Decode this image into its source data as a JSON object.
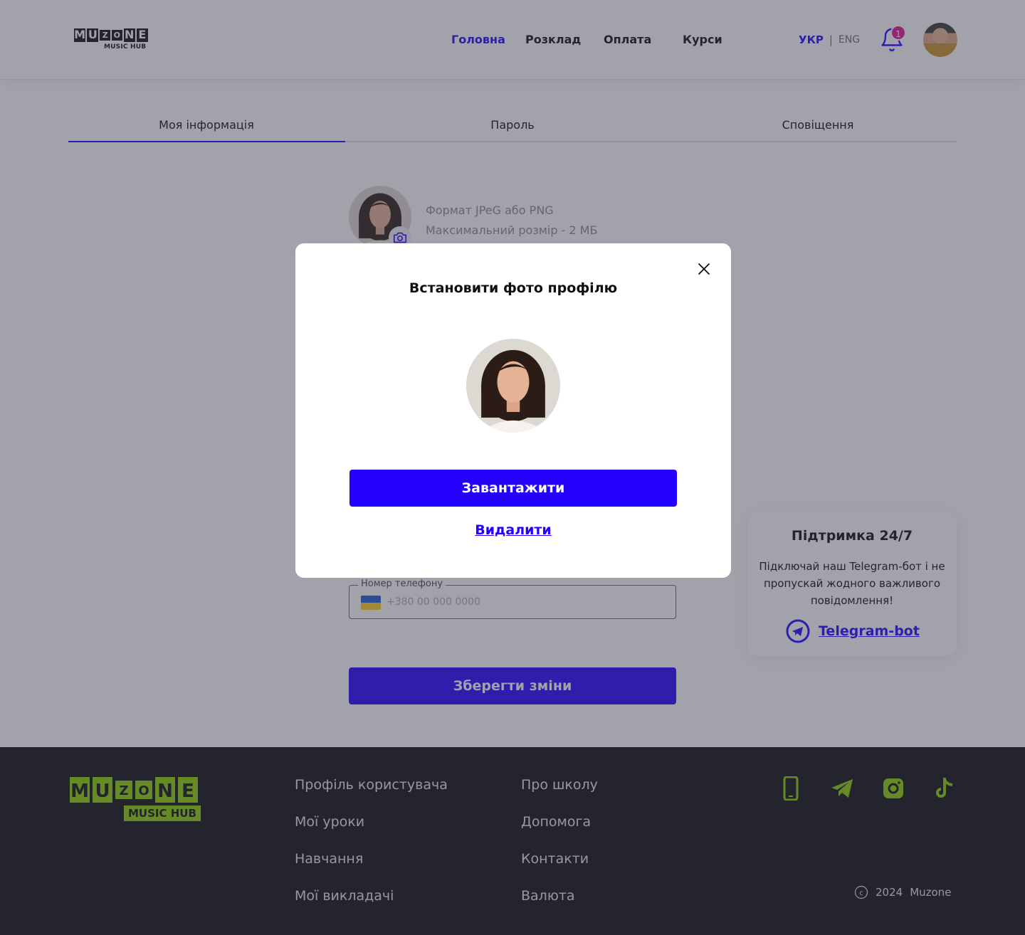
{
  "header": {
    "logo_top": "MUZONE",
    "logo_sub": "MUSIC HUB",
    "nav": [
      {
        "label": "Головна",
        "active": true
      },
      {
        "label": "Розклад",
        "active": false
      },
      {
        "label": "Оплата",
        "active": false
      },
      {
        "label": "Курси",
        "active": false
      }
    ],
    "lang_active": "УКР",
    "lang_sep": "|",
    "lang_other": "ENG",
    "notifications_count": "1"
  },
  "tabs": [
    {
      "label": "Моя інформація",
      "active": true
    },
    {
      "label": "Пароль",
      "active": false
    },
    {
      "label": "Сповіщення",
      "active": false
    }
  ],
  "profile": {
    "format_line1": "Формат JPeG або PNG",
    "format_line2": "Максимальний розмір - 2 МБ",
    "phone_label": "Номер телефону",
    "phone_placeholder": "+380 00 000 0000",
    "save_label": "Зберегти зміни"
  },
  "support": {
    "title": "Підтримка 24/7",
    "text": "Підключай наш Telegram-бот і не пропускай жодного важливого повідомлення!",
    "link": "Telegram-bot"
  },
  "footer": {
    "logo_top": "MUZONE",
    "logo_sub": "MUSIC HUB",
    "col1": [
      "Профіль користувача",
      "Мої уроки",
      "Навчання",
      "Мої викладачі"
    ],
    "col2": [
      "Про школу",
      "Допомога",
      "Контакти",
      "Валюта"
    ],
    "social": [
      "phone-icon",
      "telegram-icon",
      "instagram-icon",
      "tiktok-icon"
    ],
    "copyright_year": "2024",
    "copyright_name": "Muzone"
  },
  "modal": {
    "title": "Встановити фото профілю",
    "upload_label": "Завантажити",
    "delete_label": "Видалити"
  },
  "colors": {
    "accent": "#2400ff",
    "brand_green": "#8cd100",
    "badge": "#e0168f",
    "footer_bg": "#0f0f13"
  }
}
